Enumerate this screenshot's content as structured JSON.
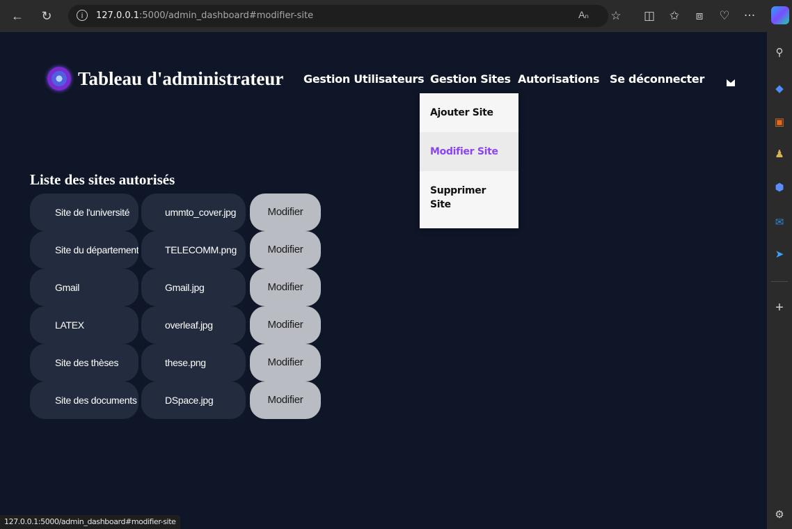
{
  "browser": {
    "url_host": "127.0.0.1",
    "url_path": ":5000/admin_dashboard#modifier-site",
    "more_label": "···"
  },
  "header": {
    "title": "Tableau d'administrateur",
    "nav": [
      {
        "label": "Gestion Utilisateurs"
      },
      {
        "label": "Gestion Sites"
      },
      {
        "label": "Autorisations"
      },
      {
        "label": "Se déconnecter"
      }
    ]
  },
  "dropdown": {
    "items": [
      {
        "label": "Ajouter Site",
        "active": false
      },
      {
        "label": "Modifier Site",
        "active": true
      },
      {
        "label": "Supprimer\nSite",
        "active": false
      }
    ]
  },
  "sites": {
    "title": "Liste des sites autorisés",
    "button_label": "Modifier",
    "rows": [
      {
        "name": "Site de l'université",
        "file": "ummto_cover.jpg"
      },
      {
        "name": "Site du département",
        "file": "TELECOMM.png"
      },
      {
        "name": "Gmail",
        "file": "Gmail.jpg"
      },
      {
        "name": "LATEX",
        "file": "overleaf.jpg"
      },
      {
        "name": "Site des thèses",
        "file": "these.png"
      },
      {
        "name": "Site des documents nu",
        "file": "DSpace.jpg"
      }
    ]
  },
  "status_bar": {
    "text": "127.0.0.1:5000/admin_dashboard#modifier-site"
  },
  "colors": {
    "page_bg": "#0f1627",
    "cell_bg": "#232c3e",
    "button_bg": "#b9bcc2",
    "active_menu": "#8b45f0"
  }
}
